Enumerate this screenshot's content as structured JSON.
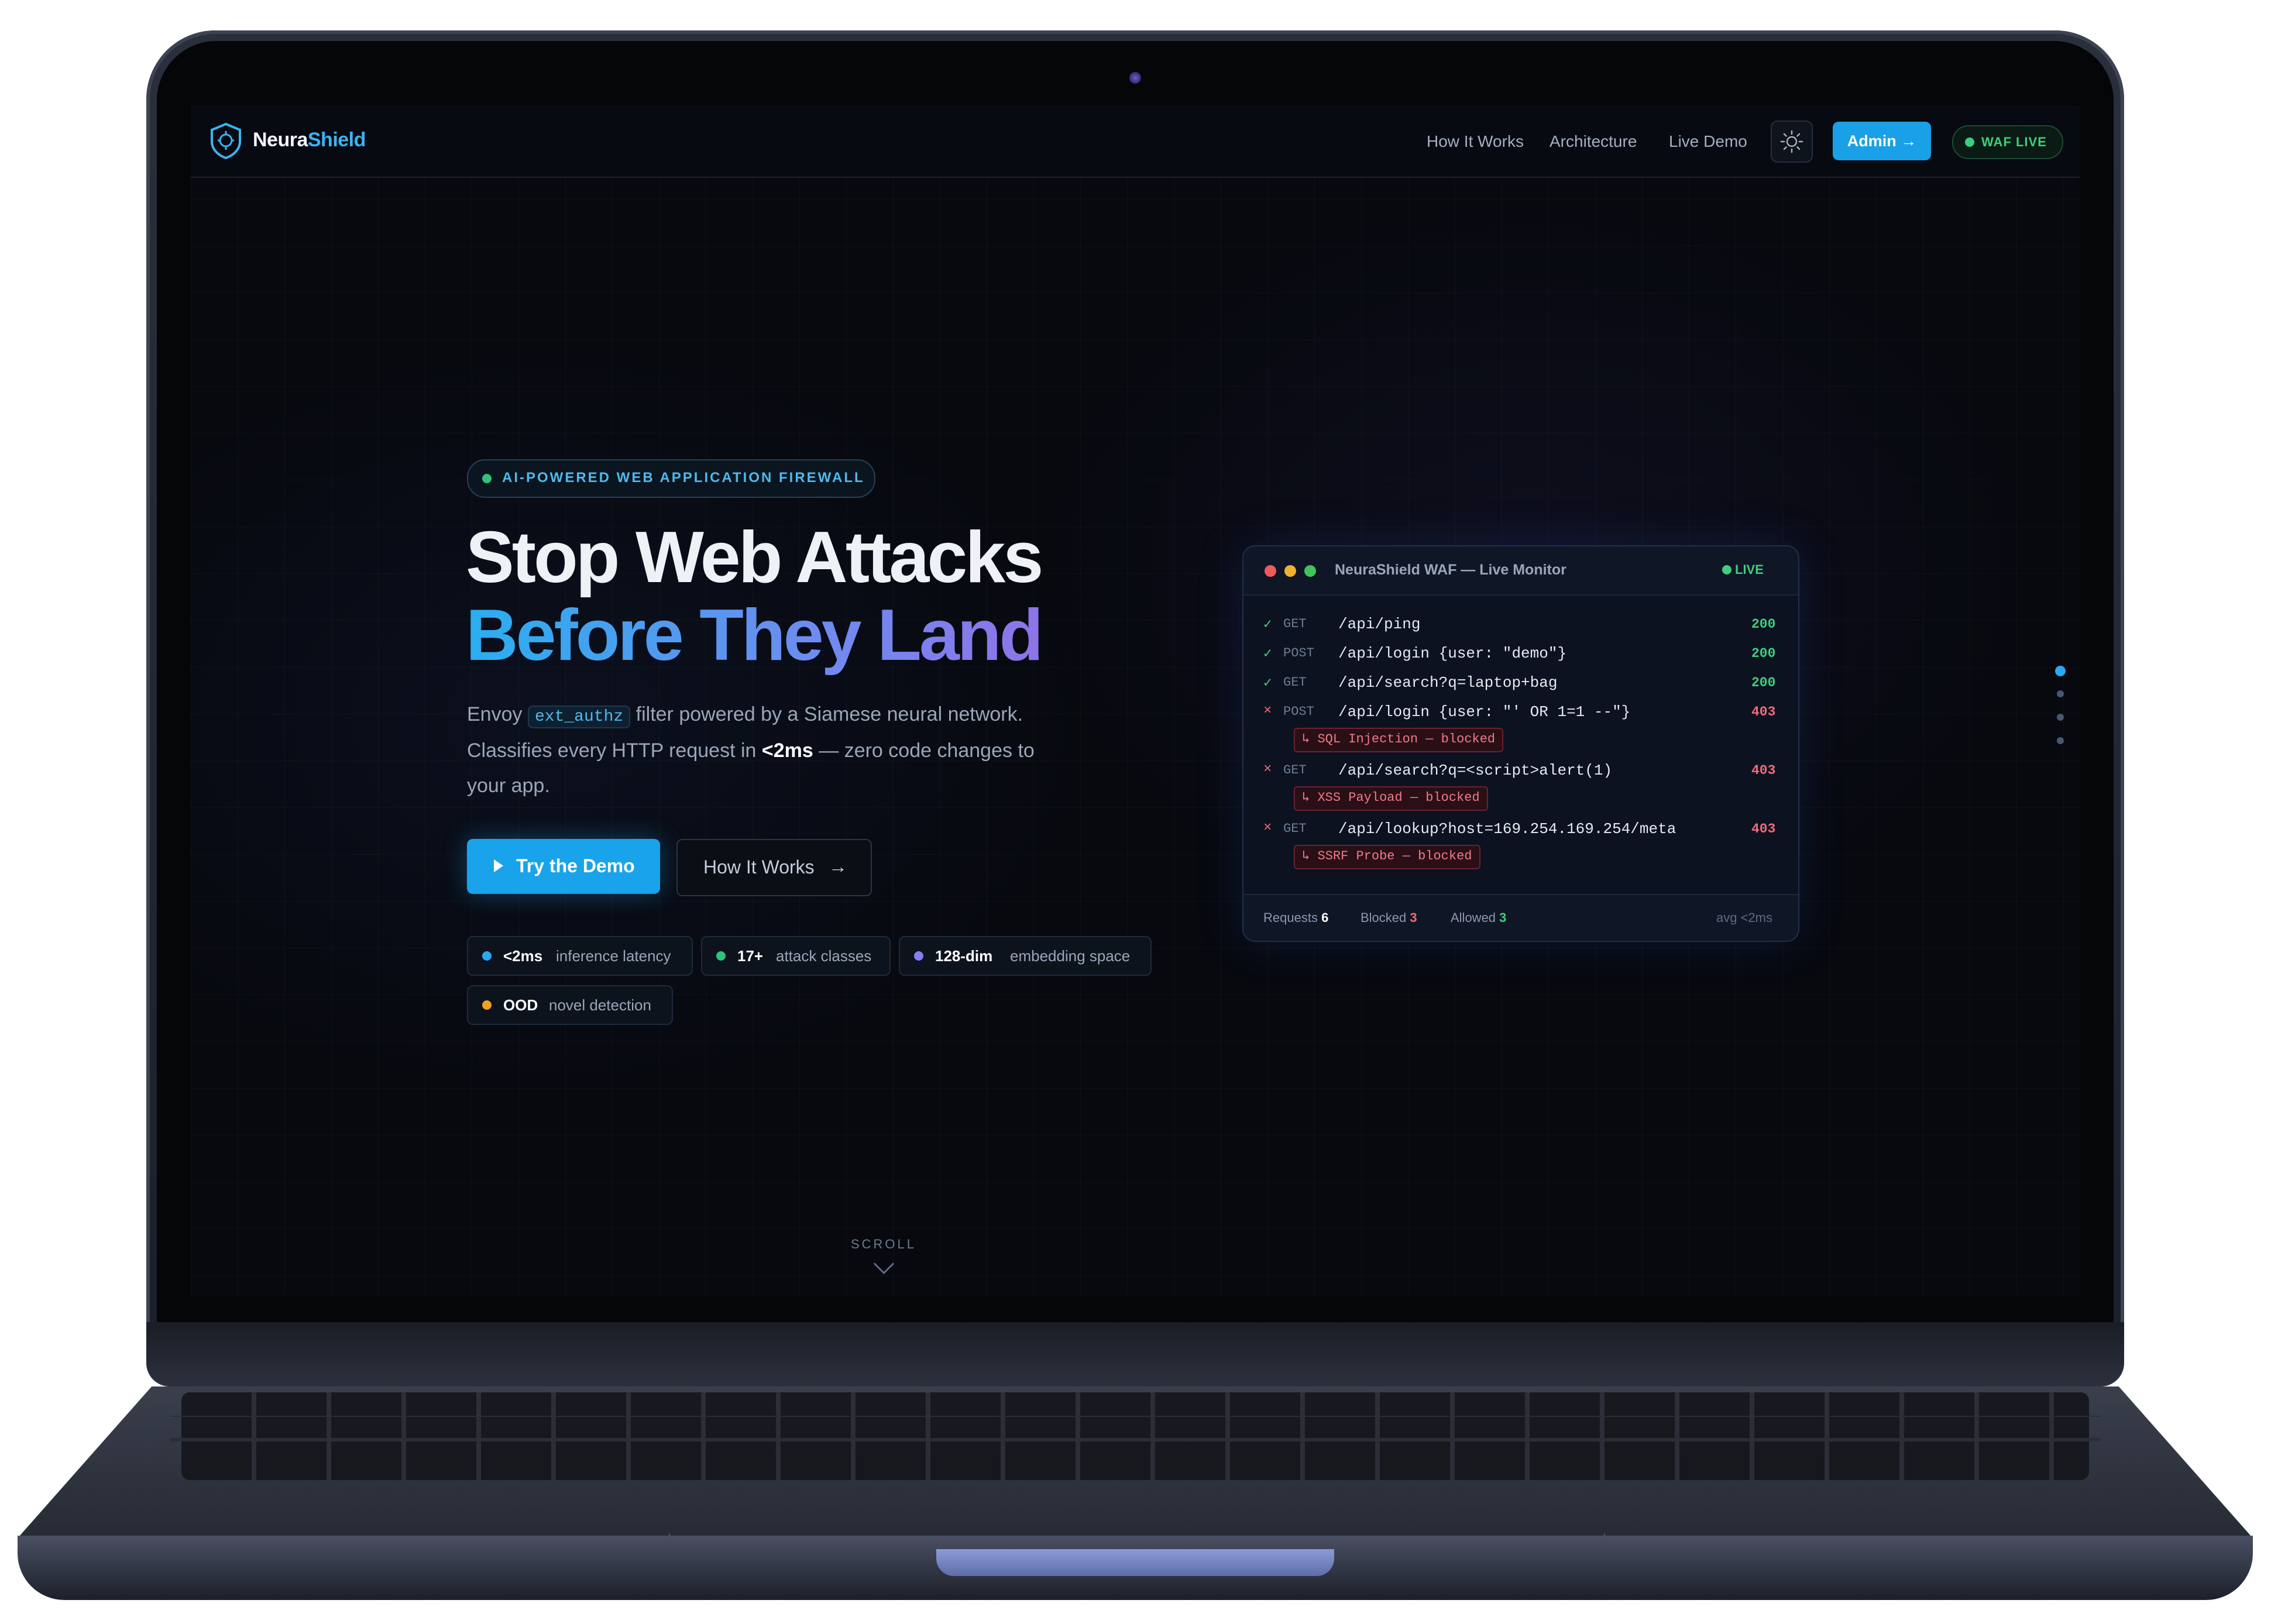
{
  "nav": {
    "brand_part1": "Neura",
    "brand_part2": "Shield",
    "links": [
      "How It Works",
      "Architecture",
      "Live Demo"
    ],
    "theme_icon": "sun-icon",
    "admin_label": "Admin →",
    "status_badge": "WAF LIVE"
  },
  "hero": {
    "eyebrow": "AI-POWERED WEB APPLICATION FIREWALL",
    "title_line1": "Stop Web Attacks",
    "title_line2": "Before They Land",
    "desc_pre": "Envoy",
    "desc_code": "ext_authz",
    "desc_post": "filter powered by a Siamese neural network.",
    "desc_line2_pre": "Classifies every HTTP request in",
    "desc_line2_bold": "<2ms",
    "desc_line2_post": "— zero code changes to",
    "desc_line3": "your app.",
    "cta_primary": "Try the Demo",
    "cta_secondary": "How It Works",
    "stats": [
      {
        "value": "<2ms",
        "label": "inference latency",
        "color": "#2aa8f0"
      },
      {
        "value": "17+",
        "label": "attack classes",
        "color": "#2ec27a"
      },
      {
        "value": "128-dim",
        "label": "embedding space",
        "color": "#8a7cf0"
      },
      {
        "value": "OOD",
        "label": "novel detection",
        "color": "#f0a020"
      }
    ],
    "scroll_label": "SCROLL"
  },
  "monitor": {
    "title": "NeuraShield WAF — Live Monitor",
    "live_label": "LIVE",
    "rows": [
      {
        "mark": "✓",
        "method": "GET",
        "path": "/api/ping",
        "status": "200",
        "tag": ""
      },
      {
        "mark": "✓",
        "method": "POST",
        "path": "/api/login {user: \"demo\"}",
        "status": "200",
        "tag": ""
      },
      {
        "mark": "✓",
        "method": "GET",
        "path": "/api/search?q=laptop+bag",
        "status": "200",
        "tag": ""
      },
      {
        "mark": "×",
        "method": "POST",
        "path": "/api/login {user: \"' OR 1=1 --\"}",
        "status": "403",
        "tag": "↳ SQL Injection — blocked"
      },
      {
        "mark": "×",
        "method": "GET",
        "path": "/api/search?q=<script>alert(1)",
        "status": "403",
        "tag": "↳ XSS Payload — blocked"
      },
      {
        "mark": "×",
        "method": "GET",
        "path": "/api/lookup?host=169.254.169.254/meta",
        "status": "403",
        "tag": "↳ SSRF Probe — blocked"
      }
    ],
    "footer": {
      "requests_label": "Requests",
      "requests_value": "6",
      "blocked_label": "Blocked",
      "blocked_value": "3",
      "allowed_label": "Allowed",
      "allowed_value": "3",
      "avg": "avg <2ms"
    }
  },
  "colors": {
    "accent": "#1aa0e6",
    "ok": "#3ecf7c",
    "blocked": "#f06a7a",
    "background": "#07090f"
  }
}
